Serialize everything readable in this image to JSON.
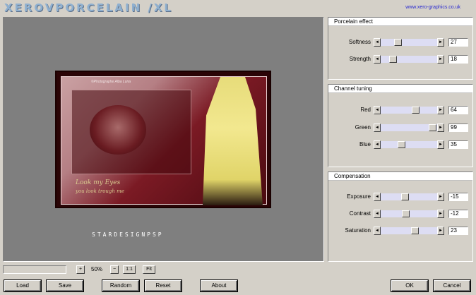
{
  "header": {
    "logo_text": "XEROVPORCELAIN /XL",
    "url": "www.xero-graphics.co.uk"
  },
  "preview": {
    "image_credit": "©Photographe Alba Luna",
    "caption_line1": "Look my Eyes",
    "caption_line2": "you look trough me",
    "signature": "STARDESIGNPSP"
  },
  "panels": {
    "porcelain": {
      "title": "Porcelain effect",
      "params": [
        {
          "label": "Softness",
          "value": "27",
          "level": 0.27
        },
        {
          "label": "Strength",
          "value": "18",
          "level": 0.18
        }
      ]
    },
    "channel": {
      "title": "Channel tuning",
      "params": [
        {
          "label": "Red",
          "value": "64",
          "level": 0.64
        },
        {
          "label": "Green",
          "value": "99",
          "level": 0.99
        },
        {
          "label": "Blue",
          "value": "35",
          "level": 0.35
        }
      ]
    },
    "compensation": {
      "title": "Compensation",
      "params": [
        {
          "label": "Exposure",
          "value": "-15",
          "level": 0.42
        },
        {
          "label": "Contrast",
          "value": "-12",
          "level": 0.44
        },
        {
          "label": "Saturation",
          "value": "23",
          "level": 0.62
        }
      ]
    }
  },
  "zoom": {
    "plus": "+",
    "value": "50%",
    "minus": "−",
    "one_to_one": "1:1",
    "fit": "Fit"
  },
  "buttons": {
    "load": "Load",
    "save": "Save",
    "random": "Random",
    "reset": "Reset",
    "about": "About",
    "ok": "OK",
    "cancel": "Cancel"
  },
  "slider_arrows": {
    "left": "◄",
    "right": "►"
  }
}
